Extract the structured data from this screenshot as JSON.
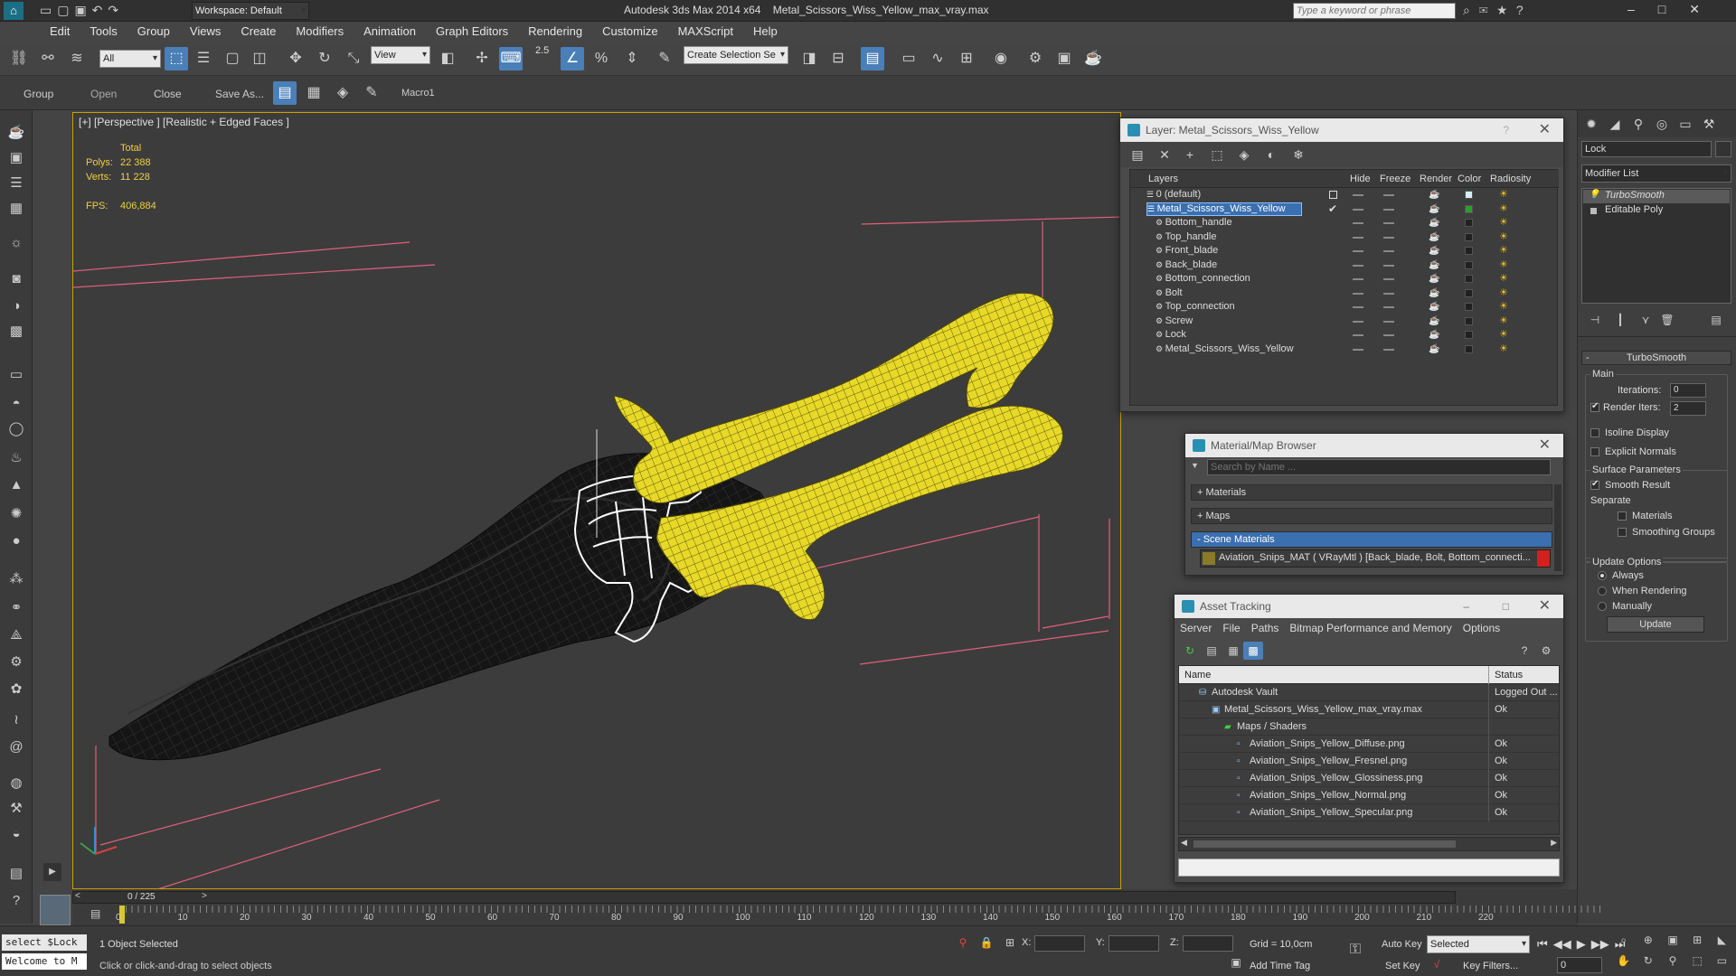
{
  "title": {
    "app": "Autodesk 3ds Max  2014 x64",
    "file": "Metal_Scissors_Wiss_Yellow_max_vray.max",
    "workspace": "Workspace: Default",
    "search_placeholder": "Type a keyword or phrase"
  },
  "menu": [
    "Edit",
    "Tools",
    "Group",
    "Views",
    "Create",
    "Modifiers",
    "Animation",
    "Graph Editors",
    "Rendering",
    "Customize",
    "MAXScript",
    "Help"
  ],
  "toolbar": {
    "filter": "All",
    "view": "View",
    "snap_value": "2.5",
    "selection_set": "Create Selection Se"
  },
  "toolbar2": {
    "group": "Group",
    "open": "Open",
    "close": "Close",
    "save_as": "Save As...",
    "macro": "Macro1"
  },
  "viewport": {
    "label": "[+] [Perspective ] [Realistic + Edged Faces ]",
    "stats": {
      "total_label": "Total",
      "polys_label": "Polys:",
      "polys": "22 388",
      "verts_label": "Verts:",
      "verts": "11 228",
      "fps_label": "FPS:",
      "fps": "406,884"
    }
  },
  "layer_window": {
    "title": "Layer: Metal_Scissors_Wiss_Yellow",
    "columns": [
      "Layers",
      "Hide",
      "Freeze",
      "Render",
      "Color",
      "Radiosity"
    ],
    "rows": [
      {
        "name": "0 (default)",
        "color": "#d8f0f0",
        "indent": 0
      },
      {
        "name": "Metal_Scissors_Wiss_Yellow",
        "color": "#2aa02a",
        "indent": 0,
        "selected": true
      },
      {
        "name": "Bottom_handle",
        "color": "#202020",
        "indent": 1
      },
      {
        "name": "Top_handle",
        "color": "#202020",
        "indent": 1
      },
      {
        "name": "Front_blade",
        "color": "#202020",
        "indent": 1
      },
      {
        "name": "Back_blade",
        "color": "#202020",
        "indent": 1
      },
      {
        "name": "Bottom_connection",
        "color": "#202020",
        "indent": 1
      },
      {
        "name": "Bolt",
        "color": "#202020",
        "indent": 1
      },
      {
        "name": "Top_connection",
        "color": "#202020",
        "indent": 1
      },
      {
        "name": "Screw",
        "color": "#202020",
        "indent": 1
      },
      {
        "name": "Lock",
        "color": "#202020",
        "indent": 1
      },
      {
        "name": "Metal_Scissors_Wiss_Yellow",
        "color": "#202020",
        "indent": 1
      }
    ]
  },
  "material_browser": {
    "title": "Material/Map Browser",
    "search_placeholder": "Search by Name ...",
    "sections": [
      "+ Materials",
      "+ Maps",
      "- Scene Materials"
    ],
    "scene_material": "Aviation_Snips_MAT ( VRayMtl ) [Back_blade, Bolt, Bottom_connecti..."
  },
  "asset_tracking": {
    "title": "Asset Tracking",
    "menu": [
      "Server",
      "File",
      "Paths",
      "Bitmap Performance and Memory",
      "Options"
    ],
    "columns": [
      "Name",
      "Status"
    ],
    "rows": [
      {
        "name": "Autodesk Vault",
        "status": "Logged Out ...",
        "indent": 1
      },
      {
        "name": "Metal_Scissors_Wiss_Yellow_max_vray.max",
        "status": "Ok",
        "indent": 2
      },
      {
        "name": "Maps / Shaders",
        "status": "",
        "indent": 3
      },
      {
        "name": "Aviation_Snips_Yellow_Diffuse.png",
        "status": "Ok",
        "indent": 4
      },
      {
        "name": "Aviation_Snips_Yellow_Fresnel.png",
        "status": "Ok",
        "indent": 4
      },
      {
        "name": "Aviation_Snips_Yellow_Glossiness.png",
        "status": "Ok",
        "indent": 4
      },
      {
        "name": "Aviation_Snips_Yellow_Normal.png",
        "status": "Ok",
        "indent": 4
      },
      {
        "name": "Aviation_Snips_Yellow_Specular.png",
        "status": "Ok",
        "indent": 4
      }
    ]
  },
  "command_panel": {
    "object_name": "Lock",
    "modifier_list": "Modifier List",
    "stack": [
      "TurboSmooth",
      "Editable Poly"
    ],
    "rollout": "TurboSmooth",
    "main": "Main",
    "iterations_label": "Iterations:",
    "iterations": "0",
    "render_iters_label": "Render Iters:",
    "render_iters": "2",
    "isoline": "Isoline Display",
    "explicit": "Explicit Normals",
    "surface": "Surface Parameters",
    "smooth_result": "Smooth Result",
    "separate": "Separate",
    "materials": "Materials",
    "smoothing_groups": "Smoothing Groups",
    "update_options": "Update Options",
    "always": "Always",
    "when_rendering": "When Rendering",
    "manually": "Manually",
    "update": "Update"
  },
  "timeline": {
    "frame": "0 / 225",
    "ticks": [
      "0",
      "10",
      "20",
      "30",
      "40",
      "50",
      "60",
      "70",
      "80",
      "90",
      "100",
      "110",
      "120",
      "130",
      "140",
      "150",
      "160",
      "170",
      "180",
      "190",
      "200",
      "210",
      "220"
    ]
  },
  "status": {
    "script": "select $Lock",
    "welcome": "Welcome to M",
    "selected": "1 Object Selected",
    "hint": "Click or click-and-drag to select objects",
    "x_label": "X:",
    "y_label": "Y:",
    "z_label": "Z:",
    "grid": "Grid = 10,0cm",
    "auto_key": "Auto Key",
    "set_key": "Set Key",
    "selected_drop": "Selected",
    "key_filters": "Key Filters...",
    "add_time_tag": "Add Time Tag",
    "frame_field": "0"
  }
}
